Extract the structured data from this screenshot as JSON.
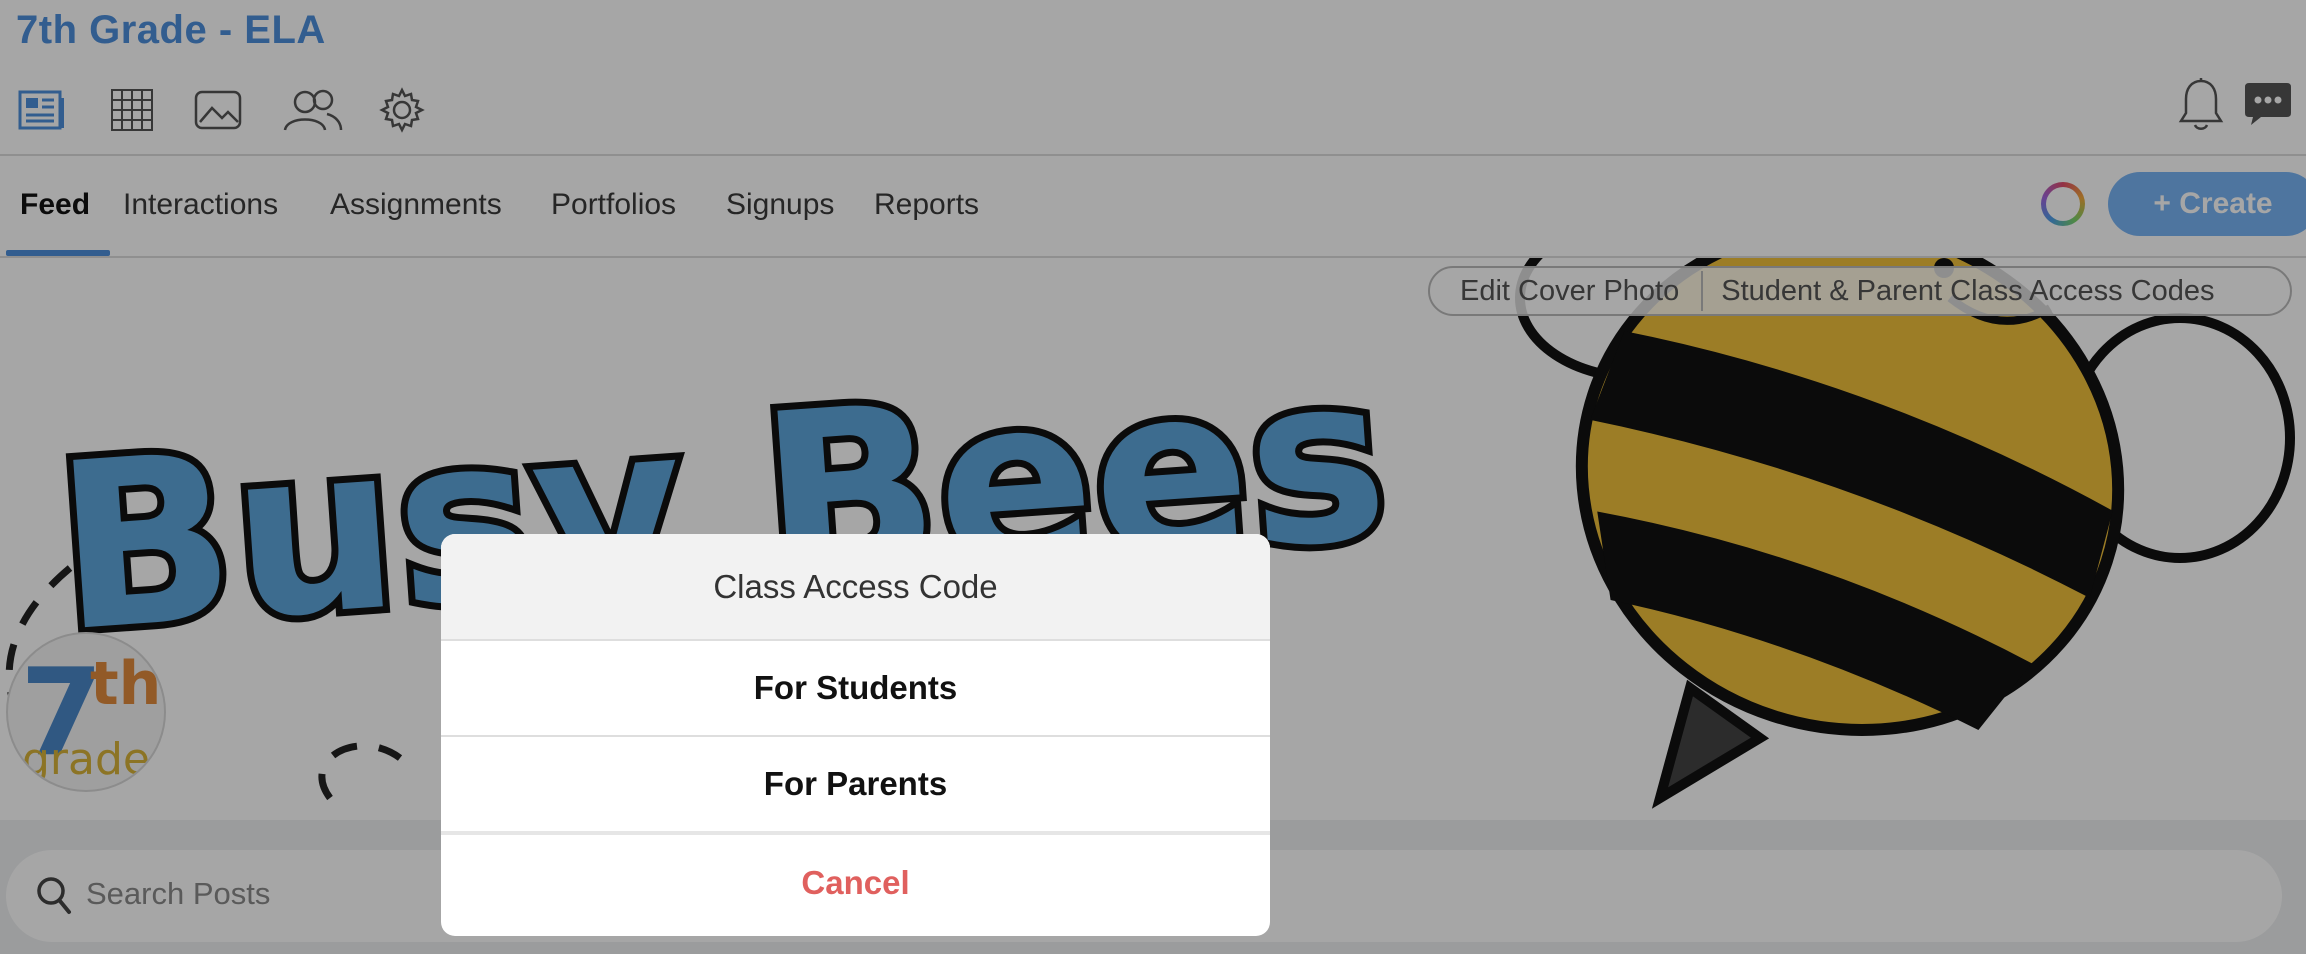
{
  "header": {
    "title": "7th Grade - ELA",
    "toolbar_icons": [
      "newsfeed-icon",
      "calendar-grid-icon",
      "photo-icon",
      "people-icon",
      "gear-icon"
    ],
    "right_icons": [
      "bell-icon",
      "chat-icon"
    ]
  },
  "tabs": [
    {
      "label": "Feed",
      "active": true
    },
    {
      "label": "Interactions"
    },
    {
      "label": "Assignments"
    },
    {
      "label": "Portfolios"
    },
    {
      "label": "Signups"
    },
    {
      "label": "Reports"
    }
  ],
  "create_button": "+ Create",
  "cover": {
    "edit_cover_label": "Edit Cover Photo",
    "access_codes_label": "Student & Parent Class Access Codes",
    "banner_text": "Busy Bees",
    "avatar_text_big": "7",
    "avatar_text_sup": "th",
    "avatar_text_small": "grade"
  },
  "search": {
    "placeholder": "Search Posts"
  },
  "dialog": {
    "title": "Class Access Code",
    "options": [
      "For Students",
      "For Parents"
    ],
    "cancel": "Cancel"
  },
  "colors": {
    "accent": "#4d8fdc",
    "create_button": "#78b4f5",
    "cancel": "#e0605e",
    "bee_yellow": "#f0c13b",
    "banner_blue": "#5ea6dc"
  }
}
